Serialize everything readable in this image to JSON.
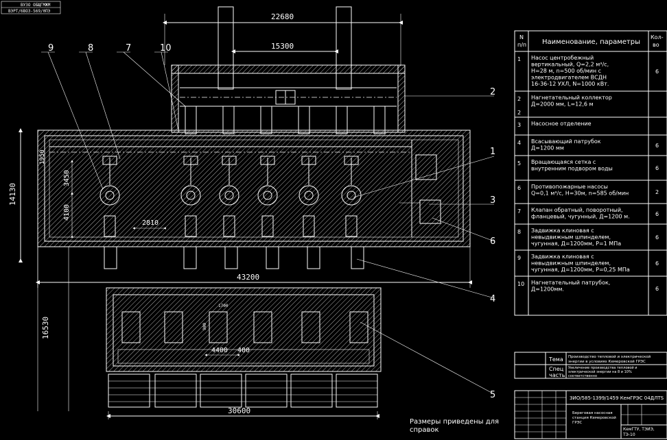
{
  "stamp": {
    "line1": "ВУЗО ОБЩГМЖМ",
    "line2": "ВЭРТ/6ВОЗ-569/0ПЭ"
  },
  "dimensions": {
    "d22680": "22680",
    "d15300": "15300",
    "d14130": "14130",
    "d1950": "1950",
    "d3450": "3450",
    "d4100": "4100",
    "d2810": "2810",
    "d43200": "43200",
    "d16530": "16530",
    "d4400": "4400",
    "d400": "400",
    "d30600": "30600",
    "d_small_a": "1700",
    "d_small_b": "900"
  },
  "callouts": {
    "c9": "9",
    "c8": "8",
    "c7": "7",
    "c10": "10",
    "c1": "1",
    "c2": "2",
    "c3": "3",
    "c6": "6",
    "c4": "4",
    "c5": "5"
  },
  "note": {
    "line1": "Размеры приведены для",
    "line2": "справок"
  },
  "spec_table": {
    "header": {
      "num_l1": "N",
      "num_l2": "п/п",
      "name": "Наименование, параметры",
      "qty_l1": "Кол-",
      "qty_l2": "во"
    },
    "rows": [
      {
        "num": "1",
        "lines": [
          "Насос центробежный",
          "вертикальный, Q=2,2 м³/с,",
          "H=28 м, n=500 об/мин с",
          "электродвигателем ВСДН",
          "16-36-12 УХЛ, N=1000 кВт."
        ],
        "qty": "6"
      },
      {
        "num": "2",
        "lines": [
          "Нагнетательный коллектор",
          "Д=2000 мм, L=12,6 м"
        ],
        "qty": "",
        "num_extra": "2"
      },
      {
        "num": "3",
        "lines": [
          "Насосное отделение"
        ],
        "qty": ""
      },
      {
        "num": "4",
        "lines": [
          "Всасывающий патрубок",
          "Д=1200 мм"
        ],
        "qty": "6"
      },
      {
        "num": "5",
        "lines": [
          "Вращающаяся сетка с",
          "внутренним подвором воды"
        ],
        "qty": "6"
      },
      {
        "num": "6",
        "lines": [
          "Противопожарные насосы",
          "Q=0,1 м³/с, H=30м, n=585 об/мин"
        ],
        "qty": "2"
      },
      {
        "num": "7",
        "lines": [
          "Клапан обратный, поворотный,",
          "фланцевый, чугунный, Д=1200 м."
        ],
        "qty": "6"
      },
      {
        "num": "8",
        "lines": [
          "Задвижка клиновая с",
          "невыдвижным шпинделем,",
          "чугунная, Д=1200мм, P=1 МПа"
        ],
        "qty": "6"
      },
      {
        "num": "9",
        "lines": [
          "Задвижка клиновая с",
          "невыдвижным шпинделем,",
          "чугунная, Д=1200мм, P=0,25 МПа"
        ],
        "qty": "6"
      },
      {
        "num": "10",
        "lines": [
          "Нагнетательный патрубок,",
          "Д=1200мм."
        ],
        "qty": "6"
      }
    ]
  },
  "title_block": {
    "tema_label": "Тема",
    "tema_text_l1": "Производство тепловой и электрической",
    "tema_text_l2": "энергии в условиях Кемеровской ГРЭС",
    "spec_label_l1": "Спец",
    "spec_label_l2": "часть",
    "spec_text_l1": "Увеличение производства тепловой и",
    "spec_text_l2": "электрической энергии на 8 и 10%",
    "spec_text_l3": "соответственно",
    "code": "ЗИО/585-1399/1459 КемГРЭС 04ДЛТS",
    "drawing_l1": "Береговая насосная",
    "drawing_l2": "станция Кемеровской",
    "drawing_l3": "ГРЭС",
    "org_l1": "КемГТУ, ТЭИЭ,",
    "org_l2": "ТЭ-10"
  }
}
